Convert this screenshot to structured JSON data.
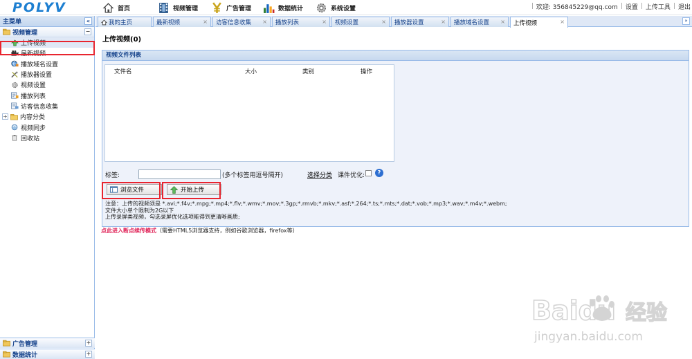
{
  "app": {
    "logo": "POLYV"
  },
  "topnav": {
    "items": [
      {
        "label": "首页",
        "icon": "home-icon"
      },
      {
        "label": "视频管理",
        "icon": "film-icon"
      },
      {
        "label": "广告管理",
        "icon": "yen-icon"
      },
      {
        "label": "数据统计",
        "icon": "bar-chart-icon"
      },
      {
        "label": "系统设置",
        "icon": "gear-icon"
      }
    ],
    "welcome": "欢迎: 356845229@qq.com",
    "settings": "设置",
    "upload_tool": "上传工具",
    "logout": "退出",
    "sep": "|"
  },
  "sidebar": {
    "title": "主菜单",
    "collapse": "«",
    "group": {
      "label": "视频管理",
      "toggle": "−"
    },
    "items": [
      {
        "label": "上传视频",
        "icon": "upload-icon"
      },
      {
        "label": "最新视频",
        "icon": "video-camera-icon"
      },
      {
        "label": "播放域名设置",
        "icon": "globe-icon"
      },
      {
        "label": "播放器设置",
        "icon": "tools-icon"
      },
      {
        "label": "视频设置",
        "icon": "settings-icon"
      },
      {
        "label": "播放列表",
        "icon": "playlist-icon"
      },
      {
        "label": "访客信息收集",
        "icon": "visitor-icon"
      },
      {
        "label": "内容分类",
        "icon": "folder-icon",
        "expander": "+"
      },
      {
        "label": "视频同步",
        "icon": "sync-icon"
      },
      {
        "label": "回收站",
        "icon": "trash-icon"
      }
    ],
    "bottom_groups": [
      {
        "label": "广告管理",
        "toggle": "+"
      },
      {
        "label": "数据统计",
        "toggle": "+"
      }
    ]
  },
  "tabs": {
    "items": [
      {
        "label": "我的主页",
        "closable": false
      },
      {
        "label": "最新视频",
        "closable": true
      },
      {
        "label": "访客信息收集",
        "closable": true
      },
      {
        "label": "播放列表",
        "closable": true
      },
      {
        "label": "视频设置",
        "closable": true
      },
      {
        "label": "播放器设置",
        "closable": true
      },
      {
        "label": "播放域名设置",
        "closable": true
      },
      {
        "label": "上传视频",
        "closable": true,
        "active": true
      }
    ],
    "close_glyph": "×",
    "scroll_glyph": "»"
  },
  "main": {
    "title": "上传视频(0)",
    "panel_title": "视频文件列表",
    "columns": [
      "文件名",
      "大小",
      "类别",
      "操作"
    ],
    "tag_label": "标签:",
    "tag_value": "",
    "tag_hint": "(多个标签用逗号隔开)",
    "category_link": "选择分类",
    "optimize_label": "课件优化:",
    "help": "?",
    "browse_button": "浏览文件",
    "upload_button": "开始上传",
    "notes": [
      "注意：上传的视频须是 *.avi;*.f4v;*.mpg;*.mp4;*.flv;*.wmv;*.mov;*.3gp;*.rmvb;*.mkv;*.asf;*.264;*.ts;*.mts;*.dat;*.vob;*.mp3;*.wav;*.m4v;*.webm;",
      "文件大小单个限制为2G以下",
      "上传录屏类视频，勾选录屏优化选项能得到更清晰画质;"
    ],
    "resume_link": "点此进入断点续传模式",
    "resume_hint": "（需要HTML5浏览器支持，例如谷歌浏览器，firefox等）"
  },
  "watermark": {
    "brand": "Baidu",
    "cn": "经验",
    "url": "jingyan.baidu.com"
  },
  "colors": {
    "accent": "#1d7fd1",
    "header_text": "#15428b",
    "highlight": "#e8252f",
    "resume_link": "#e0265a"
  }
}
